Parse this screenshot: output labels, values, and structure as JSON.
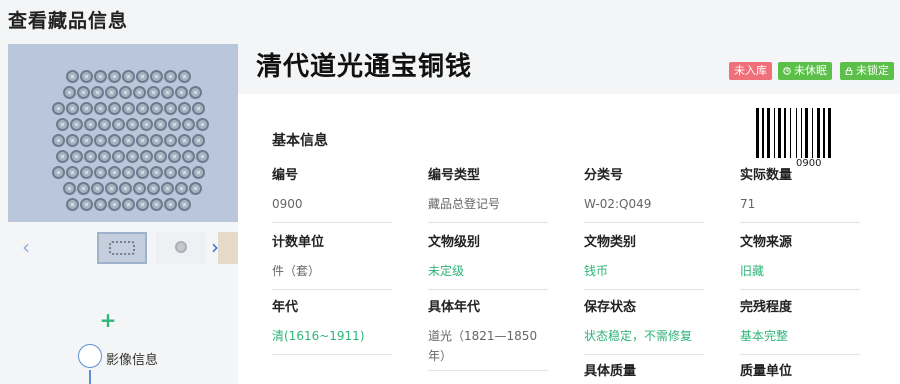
{
  "page": {
    "title": "查看藏品信息"
  },
  "relic": {
    "title": "清代道光通宝铜钱",
    "barcode_number": "0900"
  },
  "badges": {
    "storage": "未入库",
    "dormant": "未休眠",
    "lock": "未锁定"
  },
  "badge_colors": {
    "red": "#f0707a",
    "green": "#5cbf4a"
  },
  "gallery": {
    "prev_icon": "‹",
    "next_icon": "›",
    "add_icon": "+",
    "image_info_label": "影像信息"
  },
  "basic_info": {
    "section_title": "基本信息",
    "fields": [
      {
        "label": "编号",
        "value": "0900"
      },
      {
        "label": "编号类型",
        "value": "藏品总登记号"
      },
      {
        "label": "分类号",
        "value": "W-02:Q049"
      },
      {
        "label": "实际数量",
        "value": "71"
      },
      {
        "label": "计数单位",
        "value": "件（套）"
      },
      {
        "label": "文物级别",
        "value": "未定级"
      },
      {
        "label": "文物类别",
        "value": "钱币"
      },
      {
        "label": "文物来源",
        "value": "旧藏"
      },
      {
        "label": "年代",
        "value": "清(1616~1911)"
      },
      {
        "label": "具体年代",
        "value": "道光（1821—1850年）"
      },
      {
        "label": "保存状态",
        "value": "状态稳定，不需修复"
      },
      {
        "label": "完残程度",
        "value": "基本完整"
      },
      {
        "label": "具体质量",
        "value": ""
      },
      {
        "label": "质量单位",
        "value": ""
      }
    ]
  },
  "accent_color": "#2fb47a"
}
